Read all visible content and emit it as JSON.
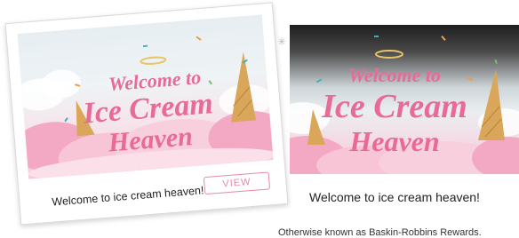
{
  "card": {
    "headline_line1": "Welcome to",
    "headline_line2": "Ice Cream",
    "headline_line3": "Heaven",
    "caption": "Welcome to ice cream heaven!",
    "view_label": "VIEW"
  },
  "banner": {
    "headline_line1": "Welcome to",
    "headline_line2": "Ice Cream",
    "headline_line3": "Heaven",
    "caption": "Welcome to ice cream heaven!",
    "subcaption": "Otherwise known as Baskin-Robbins Rewards."
  },
  "colors": {
    "headline_pink": "#e96a97",
    "button_pink": "#e58aa8",
    "halo_gold": "#e8c46a",
    "cone": "#d9a65a"
  }
}
